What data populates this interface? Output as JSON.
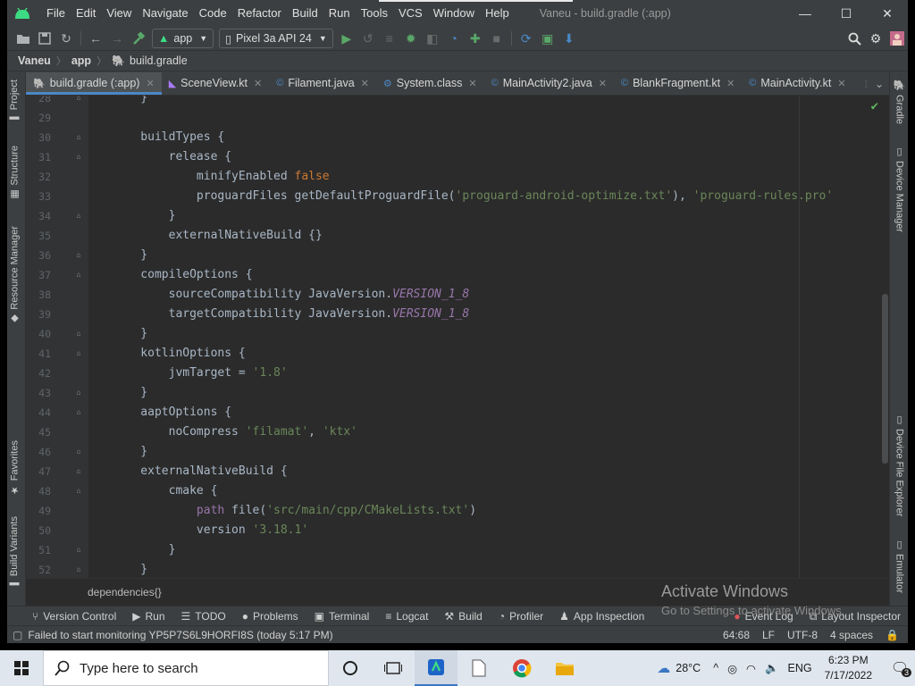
{
  "window": {
    "title": "Vaneu - build.gradle (:app)",
    "controls": {
      "minimize": "—",
      "maximize": "☐",
      "close": "✕"
    }
  },
  "menu": [
    "File",
    "Edit",
    "View",
    "Navigate",
    "Code",
    "Refactor",
    "Build",
    "Run",
    "Tools",
    "VCS",
    "Window",
    "Help"
  ],
  "toolbar": {
    "run_config": "app",
    "device": "Pixel 3a API 24"
  },
  "breadcrumb": [
    "Vaneu",
    "app",
    "build.gradle"
  ],
  "tabs": [
    {
      "label": "build.gradle (:app)",
      "active": true
    },
    {
      "label": "SceneView.kt",
      "active": false
    },
    {
      "label": "Filament.java",
      "active": false
    },
    {
      "label": "System.class",
      "active": false
    },
    {
      "label": "MainActivity2.java",
      "active": false
    },
    {
      "label": "BlankFragment.kt",
      "active": false
    },
    {
      "label": "MainActivity.kt",
      "active": false
    }
  ],
  "left_tool_tabs": [
    "Project",
    "Structure",
    "Resource Manager",
    "Favorites",
    "Build Variants"
  ],
  "right_tool_tabs": [
    "Gradle",
    "Device Manager",
    "Device File Explorer",
    "Emulator"
  ],
  "code_lines": [
    {
      "n": "28",
      "html": "    }"
    },
    {
      "n": "29",
      "html": ""
    },
    {
      "n": "30",
      "html": "    buildTypes {"
    },
    {
      "n": "31",
      "html": "        release {"
    },
    {
      "n": "32",
      "html": "            minifyEnabled <span class=\"kw\">false</span>"
    },
    {
      "n": "33",
      "html": "            proguardFiles getDefaultProguardFile(<span class=\"str\">'proguard-android-optimize.txt'</span>), <span class=\"str\">'proguard-rules.pro'</span>"
    },
    {
      "n": "34",
      "html": "        }"
    },
    {
      "n": "35",
      "html": "        externalNativeBuild {}"
    },
    {
      "n": "36",
      "html": "    }"
    },
    {
      "n": "37",
      "html": "    compileOptions {"
    },
    {
      "n": "38",
      "html": "        sourceCompatibility JavaVersion.<span class=\"ital\">VERSION_1_8</span>"
    },
    {
      "n": "39",
      "html": "        targetCompatibility JavaVersion.<span class=\"ital\">VERSION_1_8</span>"
    },
    {
      "n": "40",
      "html": "    }"
    },
    {
      "n": "41",
      "html": "    kotlinOptions {"
    },
    {
      "n": "42",
      "html": "        jvmTarget = <span class=\"str\">'1.8'</span>"
    },
    {
      "n": "43",
      "html": "    }"
    },
    {
      "n": "44",
      "html": "    aaptOptions {"
    },
    {
      "n": "45",
      "html": "        noCompress <span class=\"str\">'filamat'</span>, <span class=\"str\">'ktx'</span>"
    },
    {
      "n": "46",
      "html": "    }"
    },
    {
      "n": "47",
      "html": "    externalNativeBuild {"
    },
    {
      "n": "48",
      "html": "        cmake {"
    },
    {
      "n": "49",
      "html": "            <span class=\"prop\">path</span> file(<span class=\"str\">'src/main/cpp/CMakeLists.txt'</span>)"
    },
    {
      "n": "50",
      "html": "            version <span class=\"str\">'3.18.1'</span>"
    },
    {
      "n": "51",
      "html": "        }"
    },
    {
      "n": "52",
      "html": "    }"
    }
  ],
  "editor_breadcrumb": "dependencies{}",
  "activate": {
    "title": "Activate Windows",
    "subtitle": "Go to Settings to activate Windows."
  },
  "tool_windows": [
    "Version Control",
    "Run",
    "TODO",
    "Problems",
    "Terminal",
    "Logcat",
    "Build",
    "Profiler",
    "App Inspection"
  ],
  "tool_windows_right": [
    "Event Log",
    "Layout Inspector"
  ],
  "status": {
    "message": "Failed to start monitoring YP5P7S6L9HORFI8S (today 5:17 PM)",
    "position": "64:68",
    "line_sep": "LF",
    "encoding": "UTF-8",
    "indent": "4 spaces"
  },
  "taskbar": {
    "search_placeholder": "Type here to search",
    "weather": "28°C",
    "lang": "ENG",
    "time": "6:23 PM",
    "date": "7/17/2022",
    "notifications": "3"
  },
  "colors": {
    "accent": "#4a88c7",
    "keyword": "#cc7832",
    "string": "#6a8759",
    "field": "#9876aa",
    "run_green": "#59a869"
  }
}
